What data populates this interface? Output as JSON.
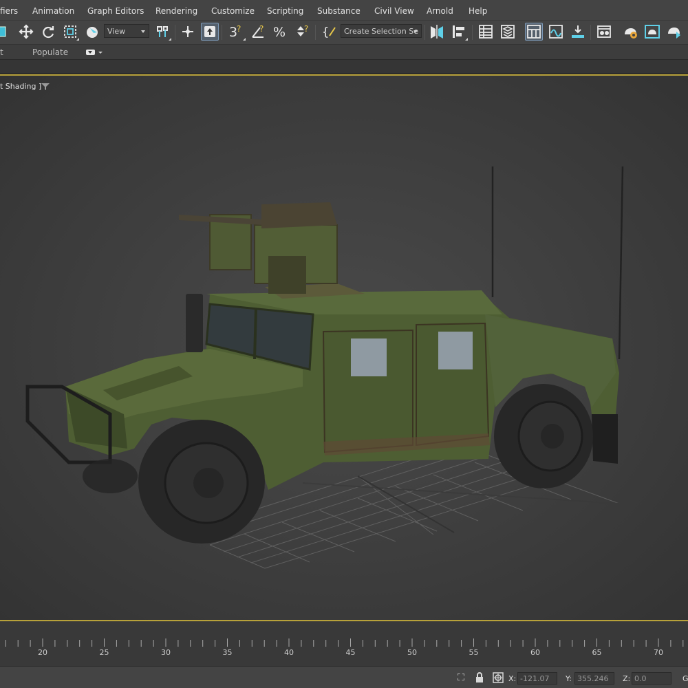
{
  "menu": {
    "items": [
      "fiers",
      "Animation",
      "Graph Editors",
      "Rendering",
      "Customize",
      "Scripting",
      "Substance",
      "Civil View",
      "Arnold",
      "Help"
    ]
  },
  "toolbar": {
    "reference_coordinate": "View",
    "named_selection": "Create Selection Se",
    "icons": [
      "select-object-icon",
      "move-icon",
      "rotate-icon",
      "scale-icon",
      "selection-filter-icon",
      "use-pivot-icon",
      "select-manipulate-icon",
      "keyboard-shortcut-icon",
      "snaps-3d-icon",
      "angle-snap-icon",
      "percent-snap-icon",
      "spinner-snap-icon",
      "edit-named-selection-icon",
      "mirror-icon",
      "align-icon",
      "scene-explorer-icon",
      "layer-explorer-icon",
      "toggle-ribbon-icon",
      "curve-editor-icon",
      "schematic-view-icon",
      "material-editor-icon",
      "render-setup-icon",
      "rendered-frame-window-icon",
      "render-icon"
    ]
  },
  "ribbon": {
    "tab_partial": "t",
    "populate": "Populate"
  },
  "viewport": {
    "label": "t Shading ]"
  },
  "timeline": {
    "ticks": [
      "20",
      "25",
      "30",
      "35",
      "40",
      "45",
      "50",
      "55",
      "60",
      "65",
      "70"
    ]
  },
  "status": {
    "x_label": "X:",
    "x_value": "-121.07",
    "y_label": "Y:",
    "y_value": "355.246",
    "z_label": "Z:",
    "z_value": "0.0",
    "grid_partial": "G"
  },
  "colors": {
    "ui_background": "#444444",
    "viewport_border": "#b8a23a",
    "vehicle_body": "#4e5e33",
    "active_button": "#55606c"
  }
}
